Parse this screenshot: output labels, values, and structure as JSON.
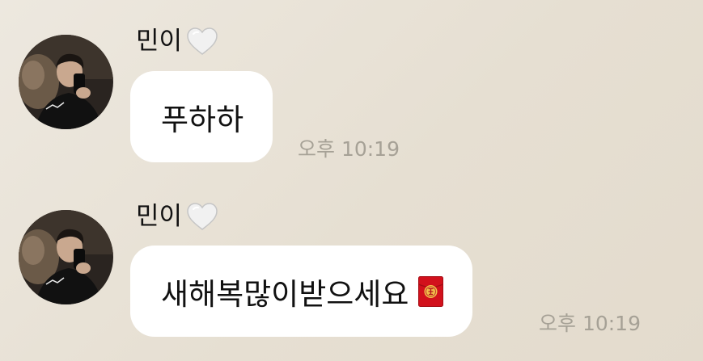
{
  "messages": [
    {
      "sender": "민이",
      "sender_icon": "white-heart-icon",
      "text": "푸하하",
      "time": "오후 10:19"
    },
    {
      "sender": "민이",
      "sender_icon": "white-heart-icon",
      "text": "새해복많이받으세요",
      "trailing_icon": "red-envelope-icon",
      "time": "오후 10:19"
    }
  ],
  "colors": {
    "background": "#e8e2d7",
    "bubble": "#ffffff",
    "timestamp": "#a6a196",
    "text": "#111111",
    "envelope": "#d2111c"
  }
}
